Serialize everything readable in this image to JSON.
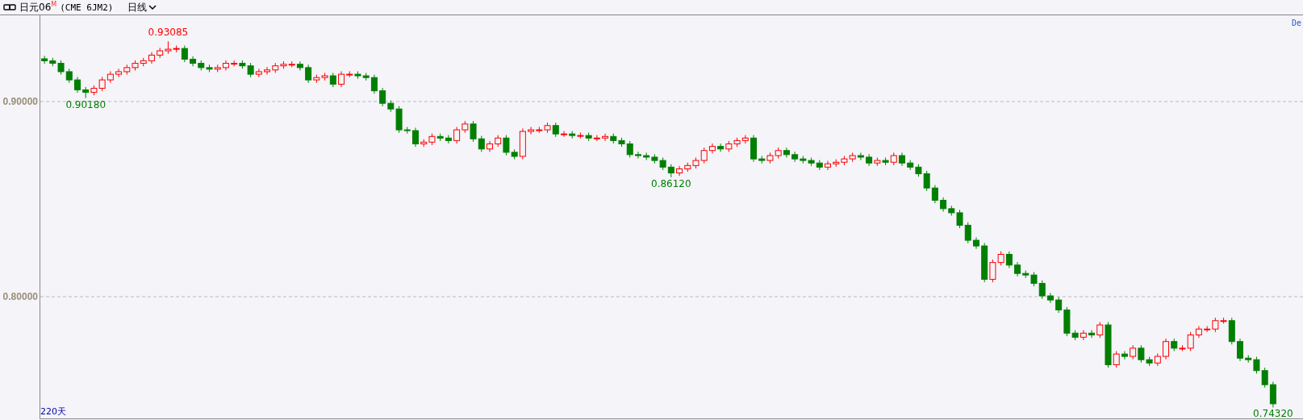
{
  "header": {
    "symbol": "日元06",
    "marker": "M",
    "contract": "(CME 6JM2)",
    "period": "日线"
  },
  "chart": {
    "corner_text": "De",
    "range_label": "220天",
    "chart_data": {
      "type": "candlestick",
      "ylim": [
        0.7372,
        0.9442
      ],
      "yticks": [
        {
          "value": 0.9,
          "label": "0.90000"
        },
        {
          "value": 0.8,
          "label": "0.80000"
        }
      ],
      "ohlc": [
        [
          0.9219,
          0.9234,
          0.9194,
          0.9209
        ],
        [
          0.9209,
          0.9224,
          0.9181,
          0.9196
        ],
        [
          0.9196,
          0.9211,
          0.9138,
          0.9153
        ],
        [
          0.9153,
          0.9168,
          0.9096,
          0.9111
        ],
        [
          0.9111,
          0.9126,
          0.9045,
          0.906
        ],
        [
          0.906,
          0.9075,
          0.9018,
          0.9047
        ],
        [
          0.9047,
          0.9083,
          0.9032,
          0.9068
        ],
        [
          0.9068,
          0.9126,
          0.9053,
          0.9111
        ],
        [
          0.9111,
          0.9155,
          0.9096,
          0.914
        ],
        [
          0.914,
          0.9168,
          0.9125,
          0.9153
        ],
        [
          0.9153,
          0.9189,
          0.9138,
          0.9174
        ],
        [
          0.9174,
          0.9211,
          0.9159,
          0.9196
        ],
        [
          0.9196,
          0.9224,
          0.9181,
          0.9209
        ],
        [
          0.9209,
          0.9253,
          0.9194,
          0.9238
        ],
        [
          0.9238,
          0.9275,
          0.9223,
          0.926
        ],
        [
          0.926,
          0.93085,
          0.9245,
          0.9268
        ],
        [
          0.9268,
          0.9287,
          0.9253,
          0.9272
        ],
        [
          0.9272,
          0.9287,
          0.9202,
          0.9217
        ],
        [
          0.9217,
          0.9232,
          0.9181,
          0.9196
        ],
        [
          0.9196,
          0.9211,
          0.9159,
          0.9174
        ],
        [
          0.9174,
          0.9189,
          0.9151,
          0.9166
        ],
        [
          0.9166,
          0.9189,
          0.9151,
          0.9174
        ],
        [
          0.9174,
          0.9211,
          0.9159,
          0.9196
        ],
        [
          0.9196,
          0.9211,
          0.9181,
          0.9196
        ],
        [
          0.9196,
          0.9211,
          0.9168,
          0.9183
        ],
        [
          0.9183,
          0.9198,
          0.9125,
          0.914
        ],
        [
          0.914,
          0.9168,
          0.9125,
          0.9153
        ],
        [
          0.9153,
          0.9177,
          0.9138,
          0.9162
        ],
        [
          0.9162,
          0.9198,
          0.9147,
          0.9183
        ],
        [
          0.9183,
          0.9206,
          0.9168,
          0.9191
        ],
        [
          0.9191,
          0.9206,
          0.9176,
          0.9191
        ],
        [
          0.9191,
          0.9206,
          0.9159,
          0.9174
        ],
        [
          0.9174,
          0.9189,
          0.9096,
          0.9111
        ],
        [
          0.9111,
          0.9138,
          0.9096,
          0.9123
        ],
        [
          0.9123,
          0.9147,
          0.9108,
          0.9132
        ],
        [
          0.9132,
          0.9147,
          0.9074,
          0.9089
        ],
        [
          0.9089,
          0.9155,
          0.9074,
          0.914
        ],
        [
          0.914,
          0.9155,
          0.9125,
          0.914
        ],
        [
          0.914,
          0.9155,
          0.9117,
          0.9132
        ],
        [
          0.9132,
          0.9147,
          0.9108,
          0.9123
        ],
        [
          0.9123,
          0.9138,
          0.904,
          0.9055
        ],
        [
          0.9055,
          0.907,
          0.8976,
          0.8991
        ],
        [
          0.8991,
          0.9006,
          0.8947,
          0.8962
        ],
        [
          0.8962,
          0.8977,
          0.884,
          0.8855
        ],
        [
          0.8855,
          0.887,
          0.8836,
          0.8851
        ],
        [
          0.8851,
          0.8866,
          0.8768,
          0.8783
        ],
        [
          0.8783,
          0.8807,
          0.8768,
          0.8792
        ],
        [
          0.8792,
          0.8836,
          0.8777,
          0.8821
        ],
        [
          0.8821,
          0.8836,
          0.8798,
          0.8813
        ],
        [
          0.8813,
          0.8828,
          0.8785,
          0.88
        ],
        [
          0.88,
          0.887,
          0.8785,
          0.8855
        ],
        [
          0.8855,
          0.89,
          0.884,
          0.8885
        ],
        [
          0.8885,
          0.89,
          0.8794,
          0.8809
        ],
        [
          0.8809,
          0.8824,
          0.8742,
          0.8757
        ],
        [
          0.8757,
          0.8798,
          0.8742,
          0.8783
        ],
        [
          0.8783,
          0.8828,
          0.8768,
          0.8813
        ],
        [
          0.8813,
          0.8828,
          0.8725,
          0.874
        ],
        [
          0.874,
          0.8755,
          0.8704,
          0.8719
        ],
        [
          0.8719,
          0.8862,
          0.8704,
          0.8847
        ],
        [
          0.8847,
          0.887,
          0.8832,
          0.8855
        ],
        [
          0.8855,
          0.887,
          0.884,
          0.8855
        ],
        [
          0.8855,
          0.8892,
          0.884,
          0.8877
        ],
        [
          0.8877,
          0.8892,
          0.8819,
          0.8834
        ],
        [
          0.8834,
          0.8849,
          0.8819,
          0.8834
        ],
        [
          0.8834,
          0.8849,
          0.8811,
          0.8826
        ],
        [
          0.8826,
          0.8841,
          0.8811,
          0.8826
        ],
        [
          0.8826,
          0.8841,
          0.8798,
          0.8813
        ],
        [
          0.8813,
          0.8828,
          0.8798,
          0.8813
        ],
        [
          0.8813,
          0.8836,
          0.8798,
          0.8821
        ],
        [
          0.8821,
          0.8836,
          0.8785,
          0.88
        ],
        [
          0.88,
          0.8815,
          0.8768,
          0.8783
        ],
        [
          0.8783,
          0.8798,
          0.8713,
          0.8728
        ],
        [
          0.8728,
          0.8743,
          0.8708,
          0.8723
        ],
        [
          0.8723,
          0.8738,
          0.87,
          0.8715
        ],
        [
          0.8715,
          0.873,
          0.8683,
          0.8698
        ],
        [
          0.8698,
          0.8713,
          0.8649,
          0.8664
        ],
        [
          0.8664,
          0.8679,
          0.8612,
          0.8634
        ],
        [
          0.8634,
          0.867,
          0.8619,
          0.8655
        ],
        [
          0.8655,
          0.8687,
          0.864,
          0.8672
        ],
        [
          0.8672,
          0.8713,
          0.8657,
          0.8698
        ],
        [
          0.8698,
          0.8764,
          0.8683,
          0.8749
        ],
        [
          0.8749,
          0.8785,
          0.8734,
          0.877
        ],
        [
          0.877,
          0.8785,
          0.8742,
          0.8757
        ],
        [
          0.8757,
          0.8798,
          0.8742,
          0.8783
        ],
        [
          0.8783,
          0.8815,
          0.8768,
          0.88
        ],
        [
          0.88,
          0.8828,
          0.8785,
          0.8813
        ],
        [
          0.8813,
          0.8828,
          0.8691,
          0.8706
        ],
        [
          0.8706,
          0.8721,
          0.8683,
          0.8698
        ],
        [
          0.8698,
          0.8738,
          0.8683,
          0.8723
        ],
        [
          0.8723,
          0.8764,
          0.8708,
          0.8749
        ],
        [
          0.8749,
          0.8764,
          0.8713,
          0.8728
        ],
        [
          0.8728,
          0.8743,
          0.8691,
          0.8706
        ],
        [
          0.8706,
          0.8721,
          0.8683,
          0.8698
        ],
        [
          0.8698,
          0.8713,
          0.867,
          0.8685
        ],
        [
          0.8685,
          0.87,
          0.8649,
          0.8664
        ],
        [
          0.8664,
          0.8696,
          0.8649,
          0.8681
        ],
        [
          0.8681,
          0.8704,
          0.8666,
          0.8689
        ],
        [
          0.8689,
          0.8721,
          0.8674,
          0.8706
        ],
        [
          0.8706,
          0.8738,
          0.8691,
          0.8723
        ],
        [
          0.8723,
          0.8738,
          0.87,
          0.8715
        ],
        [
          0.8715,
          0.873,
          0.867,
          0.8685
        ],
        [
          0.8685,
          0.8713,
          0.867,
          0.8698
        ],
        [
          0.8698,
          0.8713,
          0.8674,
          0.8689
        ],
        [
          0.8689,
          0.8738,
          0.8674,
          0.8723
        ],
        [
          0.8723,
          0.8738,
          0.867,
          0.8685
        ],
        [
          0.8685,
          0.87,
          0.8649,
          0.8664
        ],
        [
          0.8664,
          0.8679,
          0.8615,
          0.863
        ],
        [
          0.863,
          0.8645,
          0.8542,
          0.8557
        ],
        [
          0.8557,
          0.8572,
          0.8479,
          0.8494
        ],
        [
          0.8494,
          0.8509,
          0.8436,
          0.8451
        ],
        [
          0.8451,
          0.8466,
          0.8415,
          0.843
        ],
        [
          0.843,
          0.8445,
          0.8351,
          0.8366
        ],
        [
          0.8366,
          0.8381,
          0.8274,
          0.8289
        ],
        [
          0.8289,
          0.8304,
          0.8245,
          0.826
        ],
        [
          0.826,
          0.8275,
          0.8074,
          0.8089
        ],
        [
          0.8089,
          0.819,
          0.8074,
          0.8175
        ],
        [
          0.8175,
          0.8232,
          0.816,
          0.8217
        ],
        [
          0.8217,
          0.8232,
          0.8147,
          0.8162
        ],
        [
          0.8162,
          0.8177,
          0.8104,
          0.8119
        ],
        [
          0.8119,
          0.8134,
          0.8096,
          0.8111
        ],
        [
          0.8111,
          0.8126,
          0.8053,
          0.8068
        ],
        [
          0.8068,
          0.8083,
          0.7989,
          0.8004
        ],
        [
          0.8004,
          0.8019,
          0.7968,
          0.7983
        ],
        [
          0.7983,
          0.7998,
          0.7917,
          0.7932
        ],
        [
          0.7932,
          0.7947,
          0.7798,
          0.7813
        ],
        [
          0.7813,
          0.7828,
          0.7777,
          0.7792
        ],
        [
          0.7792,
          0.7828,
          0.7777,
          0.7813
        ],
        [
          0.7813,
          0.7828,
          0.7789,
          0.7804
        ],
        [
          0.7804,
          0.787,
          0.7789,
          0.7855
        ],
        [
          0.7855,
          0.787,
          0.7636,
          0.7651
        ],
        [
          0.7651,
          0.7721,
          0.7636,
          0.7706
        ],
        [
          0.7706,
          0.7721,
          0.7679,
          0.7694
        ],
        [
          0.7694,
          0.7751,
          0.7679,
          0.7736
        ],
        [
          0.7736,
          0.7751,
          0.7662,
          0.7677
        ],
        [
          0.7677,
          0.7692,
          0.7645,
          0.766
        ],
        [
          0.766,
          0.7709,
          0.7645,
          0.7694
        ],
        [
          0.7694,
          0.7785,
          0.7679,
          0.777
        ],
        [
          0.777,
          0.7785,
          0.7721,
          0.7736
        ],
        [
          0.7736,
          0.7751,
          0.7721,
          0.7736
        ],
        [
          0.7736,
          0.7819,
          0.7721,
          0.7804
        ],
        [
          0.7804,
          0.7849,
          0.7789,
          0.7834
        ],
        [
          0.7834,
          0.7849,
          0.7819,
          0.7834
        ],
        [
          0.7834,
          0.7892,
          0.7819,
          0.7877
        ],
        [
          0.7877,
          0.7892,
          0.7862,
          0.7877
        ],
        [
          0.7877,
          0.7892,
          0.7755,
          0.777
        ],
        [
          0.777,
          0.7785,
          0.767,
          0.7685
        ],
        [
          0.7685,
          0.77,
          0.7662,
          0.7677
        ],
        [
          0.7677,
          0.7692,
          0.7606,
          0.7621
        ],
        [
          0.7621,
          0.7636,
          0.7534,
          0.7549
        ],
        [
          0.7549,
          0.7564,
          0.7432,
          0.7451
        ]
      ],
      "annotations": [
        {
          "text": "0.93085",
          "y": 0.93085
        },
        {
          "text": "0.90180",
          "y": 0.9018
        },
        {
          "text": "0.86120",
          "y": 0.8612
        },
        {
          "text": "0.74320",
          "y": 0.7432
        }
      ]
    }
  }
}
